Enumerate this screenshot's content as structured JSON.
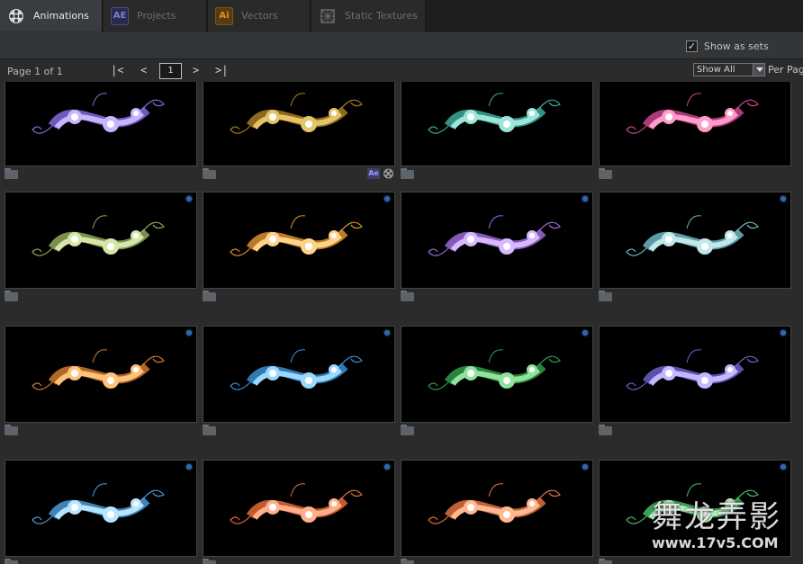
{
  "tabs": [
    {
      "label": "Animations",
      "icon": "film-reel-icon",
      "active": true
    },
    {
      "label": "Projects",
      "icon": "after-effects-icon",
      "badge": "AE",
      "active": false
    },
    {
      "label": "Vectors",
      "icon": "illustrator-icon",
      "badge": "Ai",
      "active": false
    },
    {
      "label": "Static Textures",
      "icon": "texture-icon",
      "active": false
    }
  ],
  "toolbar": {
    "show_as_sets_label": "Show as sets",
    "show_as_sets_checked": true,
    "check_mark": "✓"
  },
  "pager": {
    "page_info": "Page 1 of 1",
    "first": "|<",
    "prev": "<",
    "page_value": "1",
    "next": ">",
    "last": ">|",
    "filter_value": "Show All",
    "per_page_label": "Per Page"
  },
  "card_badges": {
    "ae": "Ae"
  },
  "colors": {
    "accent_blue": "#2f66b0",
    "ae_purple": "#9999ff",
    "ai_orange": "#ff9a00"
  },
  "watermark": {
    "cn": "舞龙弄影",
    "url": "www.17v5.COM"
  },
  "thumbnails": [
    {
      "id": "r1c1",
      "palette": [
        "#c9b5ff",
        "#7f6bd8",
        "#ffffff"
      ],
      "has_dot": false
    },
    {
      "id": "r1c2",
      "palette": [
        "#e3c46a",
        "#a57b20",
        "#ffffff"
      ],
      "has_dot": false,
      "has_badges": true
    },
    {
      "id": "r1c3",
      "palette": [
        "#9be6d8",
        "#3ea89b",
        "#ffffff"
      ],
      "has_dot": false
    },
    {
      "id": "r1c4",
      "palette": [
        "#ff9ccc",
        "#c8458c",
        "#ffffff"
      ],
      "has_dot": false
    },
    {
      "id": "r2c1",
      "palette": [
        "#d6e6a8",
        "#8fa85a",
        "#ffffff"
      ],
      "has_dot": true
    },
    {
      "id": "r2c2",
      "palette": [
        "#ffd28a",
        "#d8902e",
        "#ffffff"
      ],
      "has_dot": true
    },
    {
      "id": "r2c3",
      "palette": [
        "#d8b8ff",
        "#9a6ad8",
        "#ffffff"
      ],
      "has_dot": true
    },
    {
      "id": "r2c4",
      "palette": [
        "#bfe8ec",
        "#6fb6c0",
        "#ffffff"
      ],
      "has_dot": true
    },
    {
      "id": "r3c1",
      "palette": [
        "#ffc27a",
        "#d07a2a",
        "#ffffff"
      ],
      "has_dot": true
    },
    {
      "id": "r3c2",
      "palette": [
        "#9ad8ff",
        "#3a8ed0",
        "#ffffff"
      ],
      "has_dot": true
    },
    {
      "id": "r3c3",
      "palette": [
        "#8fe39a",
        "#2f9a4a",
        "#ffffff"
      ],
      "has_dot": true
    },
    {
      "id": "r3c4",
      "palette": [
        "#c4b6ff",
        "#6a60c8",
        "#ffffff"
      ],
      "has_dot": true
    },
    {
      "id": "r4c1",
      "palette": [
        "#b8e4ff",
        "#4a9ad8",
        "#ffffff"
      ],
      "has_dot": true
    },
    {
      "id": "r4c2",
      "palette": [
        "#ffb08a",
        "#e06a3a",
        "#ffffff"
      ],
      "has_dot": true
    },
    {
      "id": "r4c3",
      "palette": [
        "#ffb890",
        "#e07040",
        "#ffffff"
      ],
      "has_dot": true
    },
    {
      "id": "r4c4",
      "palette": [
        "#b8f0c0",
        "#4ab868",
        "#ffffff"
      ],
      "has_dot": true
    }
  ]
}
